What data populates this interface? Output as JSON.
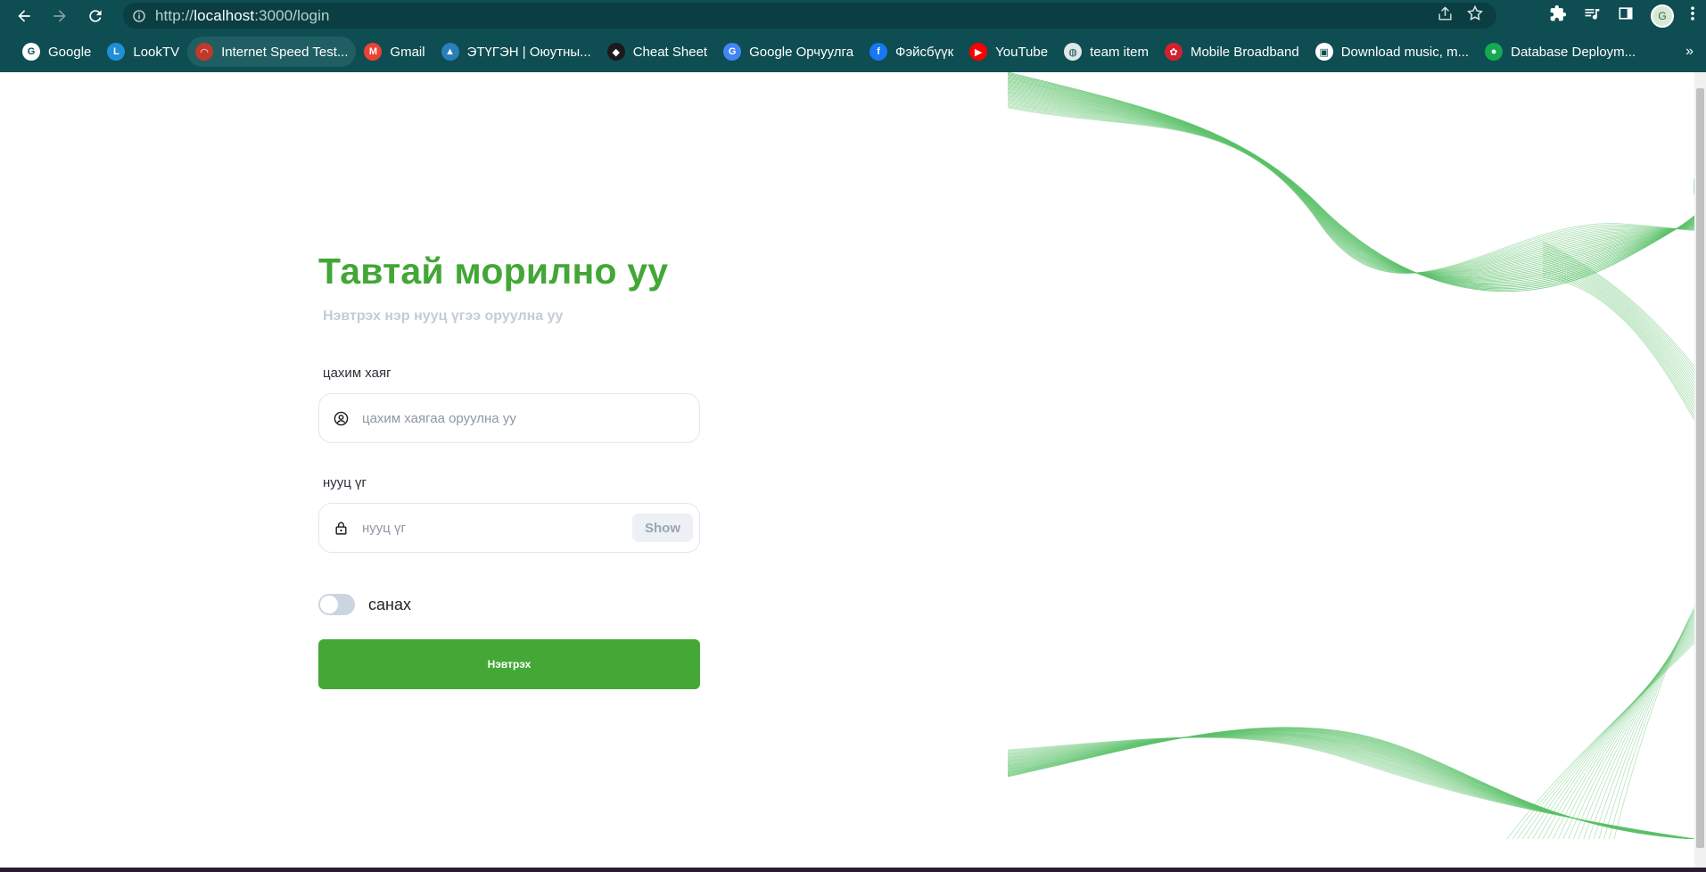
{
  "browser": {
    "url_prefix": "http://",
    "url_host": "localhost",
    "url_rest": ":3000/login",
    "profile_initial": "G"
  },
  "bookmarks": [
    {
      "label": "Google",
      "icon": "google-icon",
      "color": "#ffffff",
      "glyph": "G"
    },
    {
      "label": "LookTV",
      "icon": "looktv-icon",
      "color": "#1f8fd6",
      "glyph": "L"
    },
    {
      "label": "Internet Speed Test...",
      "icon": "speedtest-icon",
      "color": "#c0392b",
      "glyph": "◠"
    },
    {
      "label": "Gmail",
      "icon": "gmail-icon",
      "color": "#ea4335",
      "glyph": "M"
    },
    {
      "label": "ЭТҮГЭН | Оюутны...",
      "icon": "etugen-icon",
      "color": "#2a7fb8",
      "glyph": "▲"
    },
    {
      "label": "Cheat Sheet",
      "icon": "cheatsheet-icon",
      "color": "#1b1b1b",
      "glyph": "◆"
    },
    {
      "label": "Google Орчуулга",
      "icon": "translate-icon",
      "color": "#4285f4",
      "glyph": "G"
    },
    {
      "label": "Фэйсбүүк",
      "icon": "facebook-icon",
      "color": "#1877f2",
      "glyph": "f"
    },
    {
      "label": "YouTube",
      "icon": "youtube-icon",
      "color": "#ff0000",
      "glyph": "▶"
    },
    {
      "label": "team item",
      "icon": "globe-icon",
      "color": "#dfe7e8",
      "glyph": "◍"
    },
    {
      "label": "Mobile Broadband",
      "icon": "huawei-icon",
      "color": "#d3202f",
      "glyph": "✿"
    },
    {
      "label": "Download music, m...",
      "icon": "download-icon",
      "color": "#ffffff",
      "glyph": "▣"
    },
    {
      "label": "Database Deploym...",
      "icon": "mongodb-icon",
      "color": "#13aa52",
      "glyph": "●"
    }
  ],
  "login": {
    "title": "Тавтай морилно уу",
    "subtitle": "Нэвтрэх нэр нууц үгээ оруулна уу",
    "email_label": "цахим хаяг",
    "email_placeholder": "цахим хаягаа оруулна уу",
    "email_value": "",
    "password_label": "нууц үг",
    "password_placeholder": "нууц үг",
    "password_value": "",
    "show_label": "Show",
    "remember_label": "санах",
    "remember_checked": false,
    "submit_label": "Нэвтрэх"
  },
  "colors": {
    "accent": "#44a836",
    "title": "#42a736",
    "chrome": "#0e4d52",
    "wave": "#5cc26a"
  }
}
